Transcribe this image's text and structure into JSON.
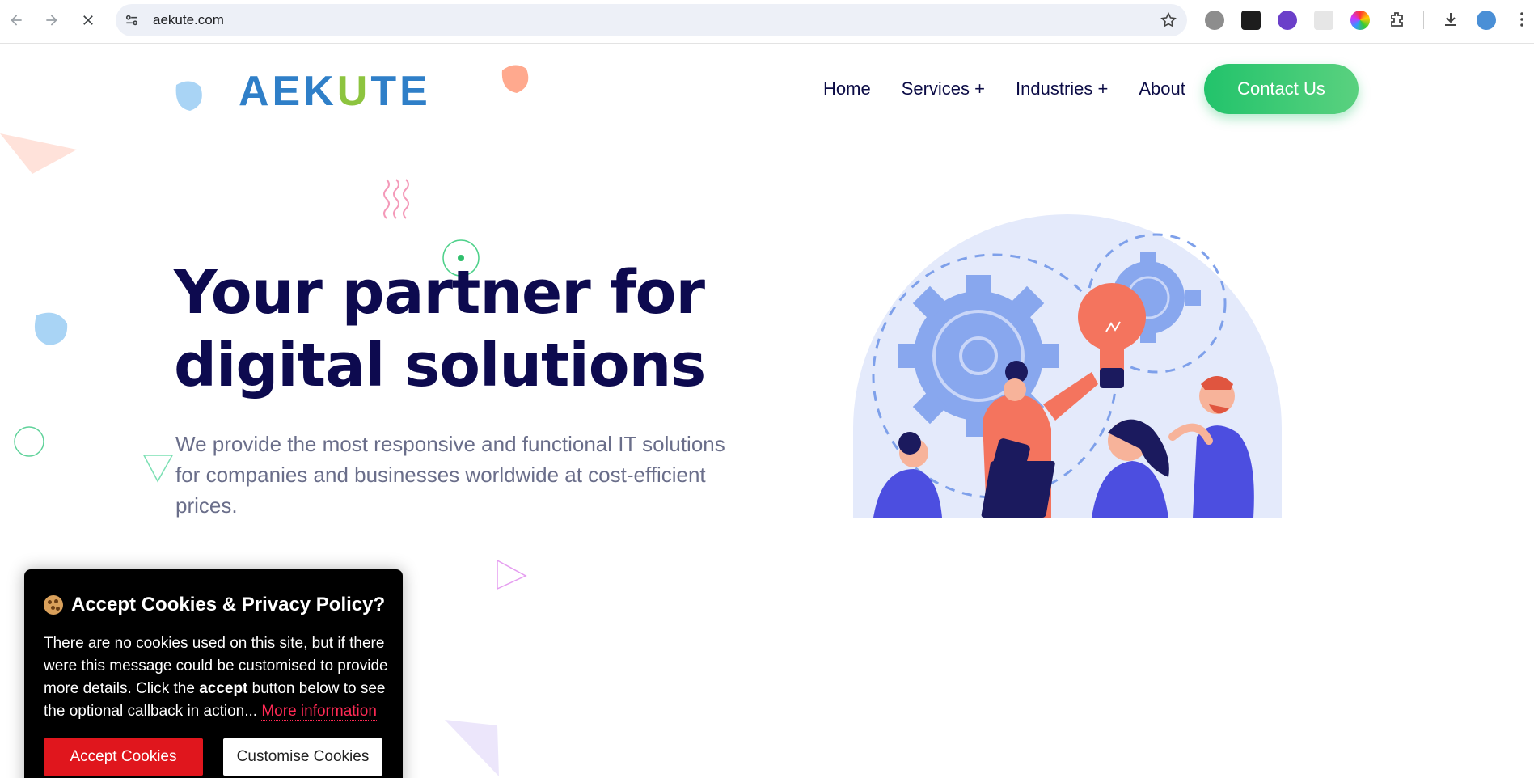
{
  "browser": {
    "url": "aekute.com",
    "back_icon": "back-arrow-icon",
    "forward_icon": "forward-arrow-icon",
    "stop_icon": "close-icon"
  },
  "site": {
    "logo_text_part1": "AEK",
    "logo_text_highlight": "U",
    "logo_text_part2": "TE",
    "nav": [
      {
        "label": "Home"
      },
      {
        "label": "Services +"
      },
      {
        "label": "Industries +"
      },
      {
        "label": "About"
      }
    ],
    "contact_label": "Contact Us",
    "colors": {
      "primary_blue": "#2f7fc8",
      "accent_green": "#22c36b",
      "heading": "#0d0a4f",
      "cookie_red": "#e0161d"
    }
  },
  "hero": {
    "headline_line1": "Your partner for",
    "headline_line2": "digital solutions",
    "lead": "We provide the most responsive and functional IT solutions for companies and businesses worldwide at cost-efficient prices."
  },
  "cookie": {
    "title": "Accept Cookies & Privacy Policy?",
    "text_1": "There are no cookies used on this site, but if there were this message could be customised to provide more details. Click the ",
    "text_bold": "accept",
    "text_2": " button below to see the optional callback in action... ",
    "more_link": "More information",
    "accept_label": "Accept Cookies",
    "customise_label": "Customise Cookies"
  }
}
